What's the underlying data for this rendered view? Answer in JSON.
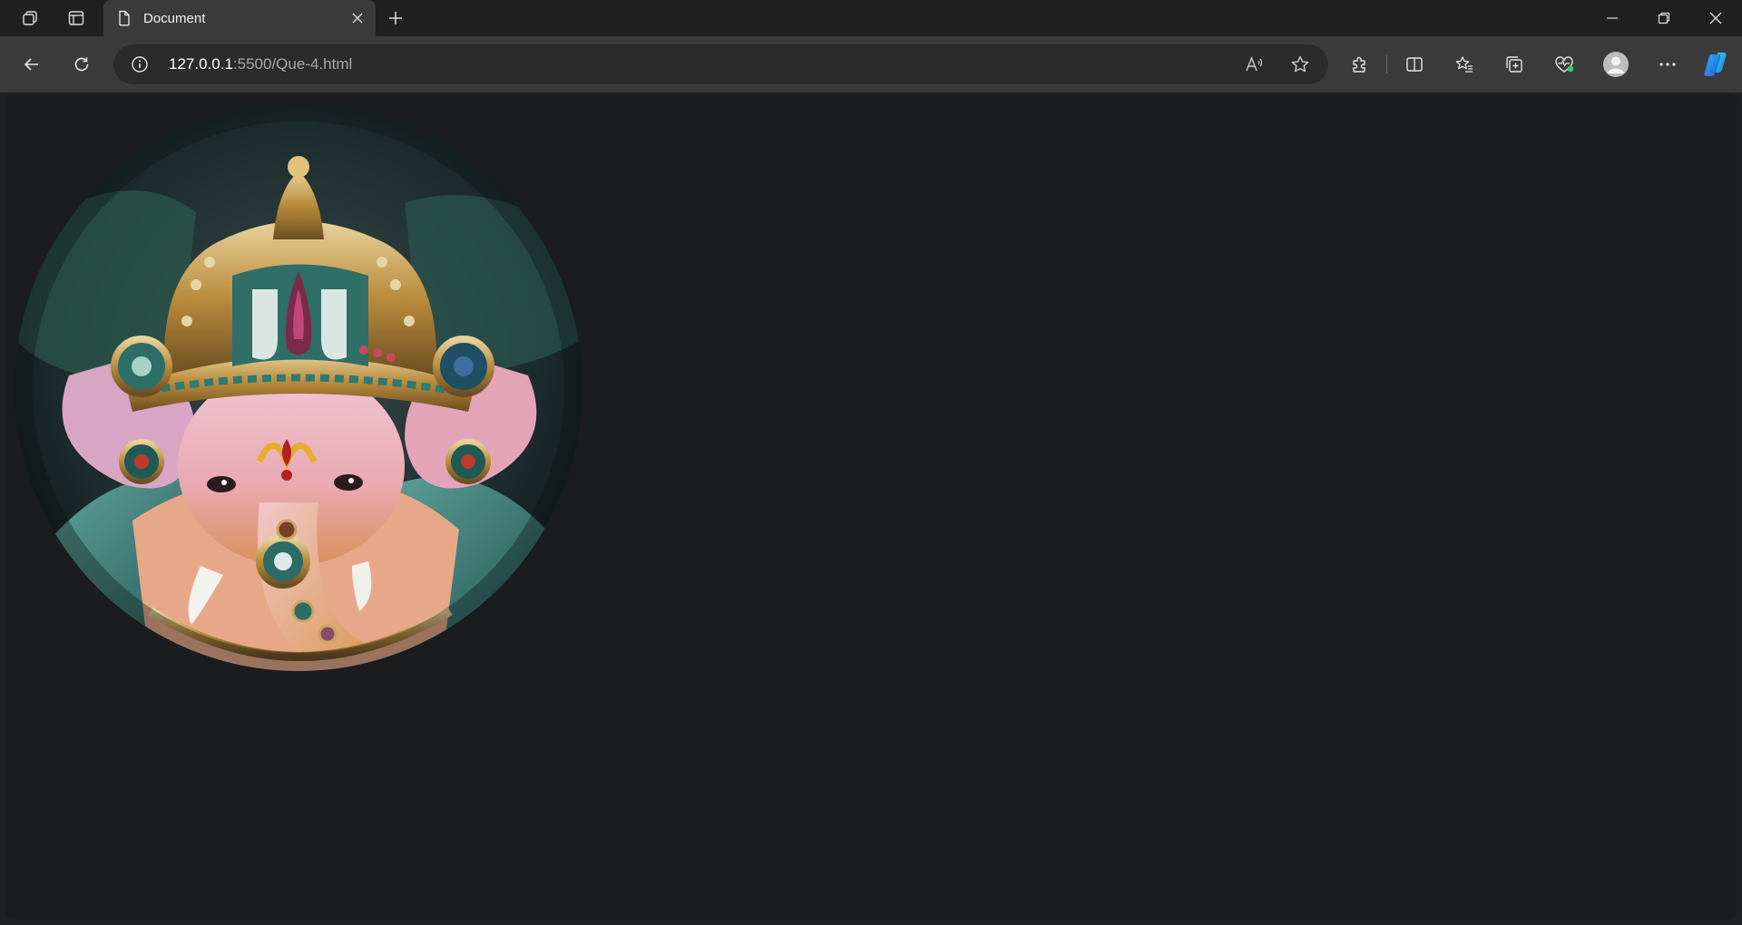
{
  "browser": {
    "tab": {
      "title": "Document",
      "icon": "page-icon",
      "close_icon": "close-icon"
    },
    "new_tab_icon": "plus-icon",
    "address": {
      "host": "127.0.0.1",
      "path": ":5500/Que-4.html",
      "info_icon": "info-icon"
    },
    "toolbar_icons": [
      "back-arrow-icon",
      "refresh-icon",
      "read-aloud-icon",
      "favorite-star-icon",
      "extensions-icon",
      "split-screen-icon",
      "favorites-icon",
      "collections-icon",
      "browser-essentials-icon",
      "profile-avatar-icon",
      "more-menu-icon",
      "copilot-icon"
    ],
    "window_controls": [
      "minimize-icon",
      "restore-icon",
      "close-window-icon"
    ]
  },
  "page": {
    "image": {
      "shape": "circle",
      "subject": "Ganesha idol with jeweled crown"
    }
  },
  "colors": {
    "tabstrip": "#202020",
    "toolbar": "#3b3b3b",
    "omnibox": "#2b2b2b",
    "page_background": "#1b1c1e"
  }
}
